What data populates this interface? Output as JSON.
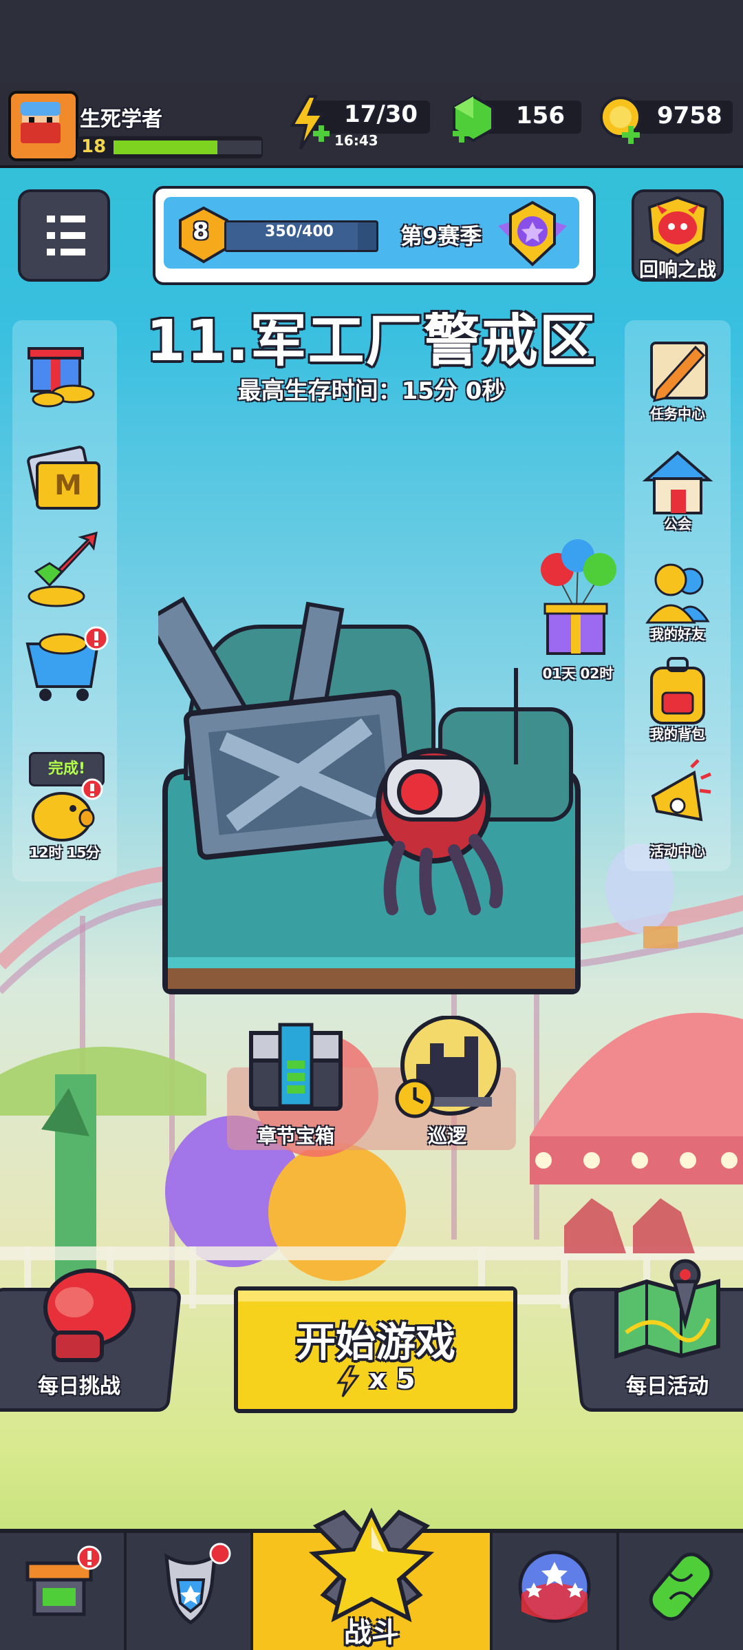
{
  "player": {
    "name": "生死学者",
    "level": "18",
    "xp_fraction": 0.7
  },
  "resources": {
    "energy": "17/30",
    "energy_timer": "16:43",
    "gems": "156",
    "coins": "9758"
  },
  "season": {
    "rank": "8",
    "progress": "350/400",
    "progress_fraction": 0.875,
    "label": "第9赛季"
  },
  "event_top_right": {
    "label": "回响之战"
  },
  "stage": {
    "title": "11.军工厂警戒区",
    "best_time": "最高生存时间：15分 0秒"
  },
  "left_sidebar": {
    "piggy_badge": "完成!",
    "piggy_timer": "12时 15分"
  },
  "right_sidebar": {
    "items": [
      {
        "label": "任务中心"
      },
      {
        "label": "公会"
      },
      {
        "label": "我的好友"
      },
      {
        "label": "我的背包"
      },
      {
        "label": "活动中心"
      }
    ]
  },
  "balloon_gift": {
    "timer": "01天 02时"
  },
  "chapter_chest": {
    "label": "章节宝箱"
  },
  "patrol": {
    "label": "巡逻"
  },
  "daily_challenge": {
    "label": "每日挑战"
  },
  "start_game": {
    "label": "开始游戏",
    "cost": "x 5"
  },
  "daily_event": {
    "label": "每日活动"
  },
  "bottom_nav": {
    "battle_label": "战斗"
  },
  "colors": {
    "accent_yellow": "#f7d21c",
    "header_dark": "#2c2d38",
    "xp_green": "#7ed321",
    "badge_red": "#e8303a"
  }
}
